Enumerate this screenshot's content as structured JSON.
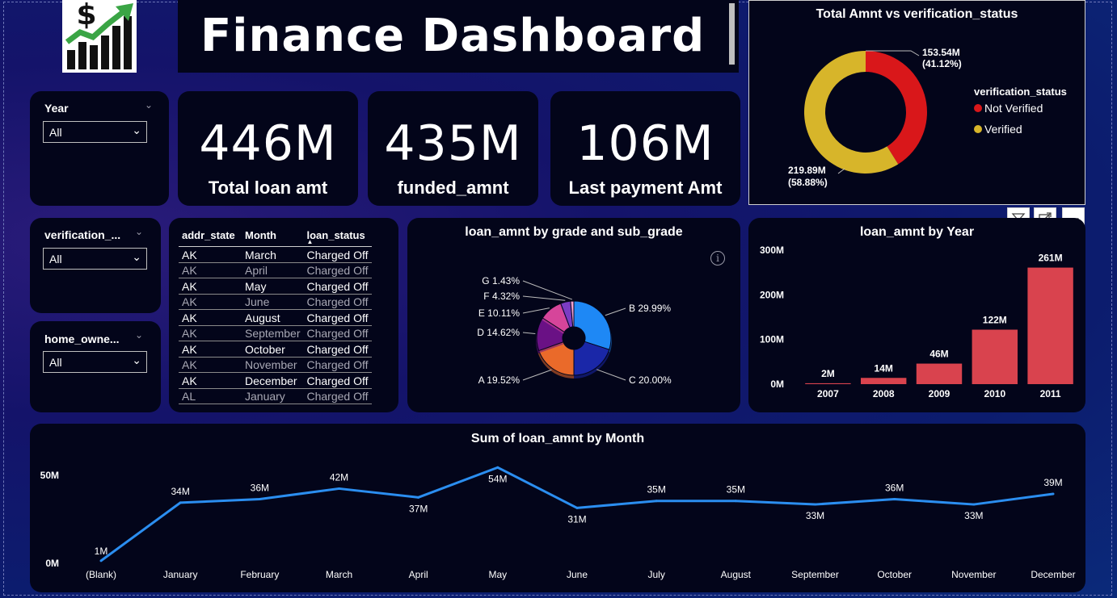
{
  "dashboard": {
    "title": "Finance Dashboard"
  },
  "slicers": [
    {
      "label": "Year",
      "value": "All"
    },
    {
      "label": "verification_...",
      "value": "All"
    },
    {
      "label": "home_owne...",
      "value": "All"
    }
  ],
  "kpis": [
    {
      "value": "446M",
      "label": "Total loan amt"
    },
    {
      "value": "435M",
      "label": "funded_amnt"
    },
    {
      "value": "106M",
      "label": "Last payment Amt"
    }
  ],
  "table": {
    "columns": [
      "addr_state",
      "Month",
      "loan_status"
    ],
    "rows": [
      [
        "AK",
        "March",
        "Charged Off"
      ],
      [
        "AK",
        "April",
        "Charged Off"
      ],
      [
        "AK",
        "May",
        "Charged Off"
      ],
      [
        "AK",
        "June",
        "Charged Off"
      ],
      [
        "AK",
        "August",
        "Charged Off"
      ],
      [
        "AK",
        "September",
        "Charged Off"
      ],
      [
        "AK",
        "October",
        "Charged Off"
      ],
      [
        "AK",
        "November",
        "Charged Off"
      ],
      [
        "AK",
        "December",
        "Charged Off"
      ],
      [
        "AL",
        "January",
        "Charged Off"
      ]
    ]
  },
  "visual_toolbar": {
    "filter_icon": "filter-icon",
    "focus_icon": "focus-mode-icon",
    "more_icon": "more-options-icon"
  },
  "colors": {
    "not_verified": "#d9171a",
    "verified": "#d7b52a",
    "bar": "#d9434e",
    "line": "#2b8ef0",
    "card": "#03051a"
  },
  "chart_data": [
    {
      "type": "pie",
      "title": "Total Amnt vs verification_status",
      "legend_title": "verification_status",
      "legend_position": "right",
      "slices": [
        {
          "name": "Not Verified",
          "value": 153.54,
          "label": "153.54M",
          "pct": "(41.12%)"
        },
        {
          "name": "Verified",
          "value": 219.89,
          "label": "219.89M",
          "pct": "(58.88%)"
        }
      ]
    },
    {
      "type": "pie",
      "title": "loan_amnt by grade and sub_grade",
      "slices": [
        {
          "name": "B",
          "value": 29.99,
          "label": "B 29.99%",
          "color": "#1e88f5"
        },
        {
          "name": "C",
          "value": 20.0,
          "label": "C 20.00%",
          "color": "#1a27a8"
        },
        {
          "name": "A",
          "value": 19.52,
          "label": "A 19.52%",
          "color": "#ea6a2a"
        },
        {
          "name": "D",
          "value": 14.62,
          "label": "D 14.62%",
          "color": "#6a1185"
        },
        {
          "name": "E",
          "value": 10.11,
          "label": "E 10.11%",
          "color": "#d6459a"
        },
        {
          "name": "F",
          "value": 4.32,
          "label": "F 4.32%",
          "color": "#7b3cc4"
        },
        {
          "name": "G",
          "value": 1.43,
          "label": "G 1.43%",
          "color": "#f0a0d0"
        }
      ]
    },
    {
      "type": "bar",
      "title": "loan_amnt by Year",
      "categories": [
        "2007",
        "2008",
        "2009",
        "2010",
        "2011"
      ],
      "values": [
        2,
        14,
        46,
        122,
        261
      ],
      "data_labels": [
        "2M",
        "14M",
        "46M",
        "122M",
        "261M"
      ],
      "y_ticks": [
        "0M",
        "100M",
        "200M",
        "300M"
      ],
      "ylim": [
        0,
        300
      ],
      "grid": false
    },
    {
      "type": "line",
      "title": "Sum of loan_amnt by Month",
      "categories": [
        "(Blank)",
        "January",
        "February",
        "March",
        "April",
        "May",
        "June",
        "July",
        "August",
        "September",
        "October",
        "November",
        "December"
      ],
      "values": [
        1,
        34,
        36,
        42,
        37,
        54,
        31,
        35,
        35,
        33,
        36,
        33,
        39
      ],
      "data_labels": [
        "1M",
        "34M",
        "36M",
        "42M",
        "37M",
        "54M",
        "31M",
        "35M",
        "35M",
        "33M",
        "36M",
        "33M",
        "39M"
      ],
      "y_ticks": [
        "0M",
        "50M"
      ],
      "ylim": [
        0,
        50
      ],
      "grid": false
    }
  ]
}
